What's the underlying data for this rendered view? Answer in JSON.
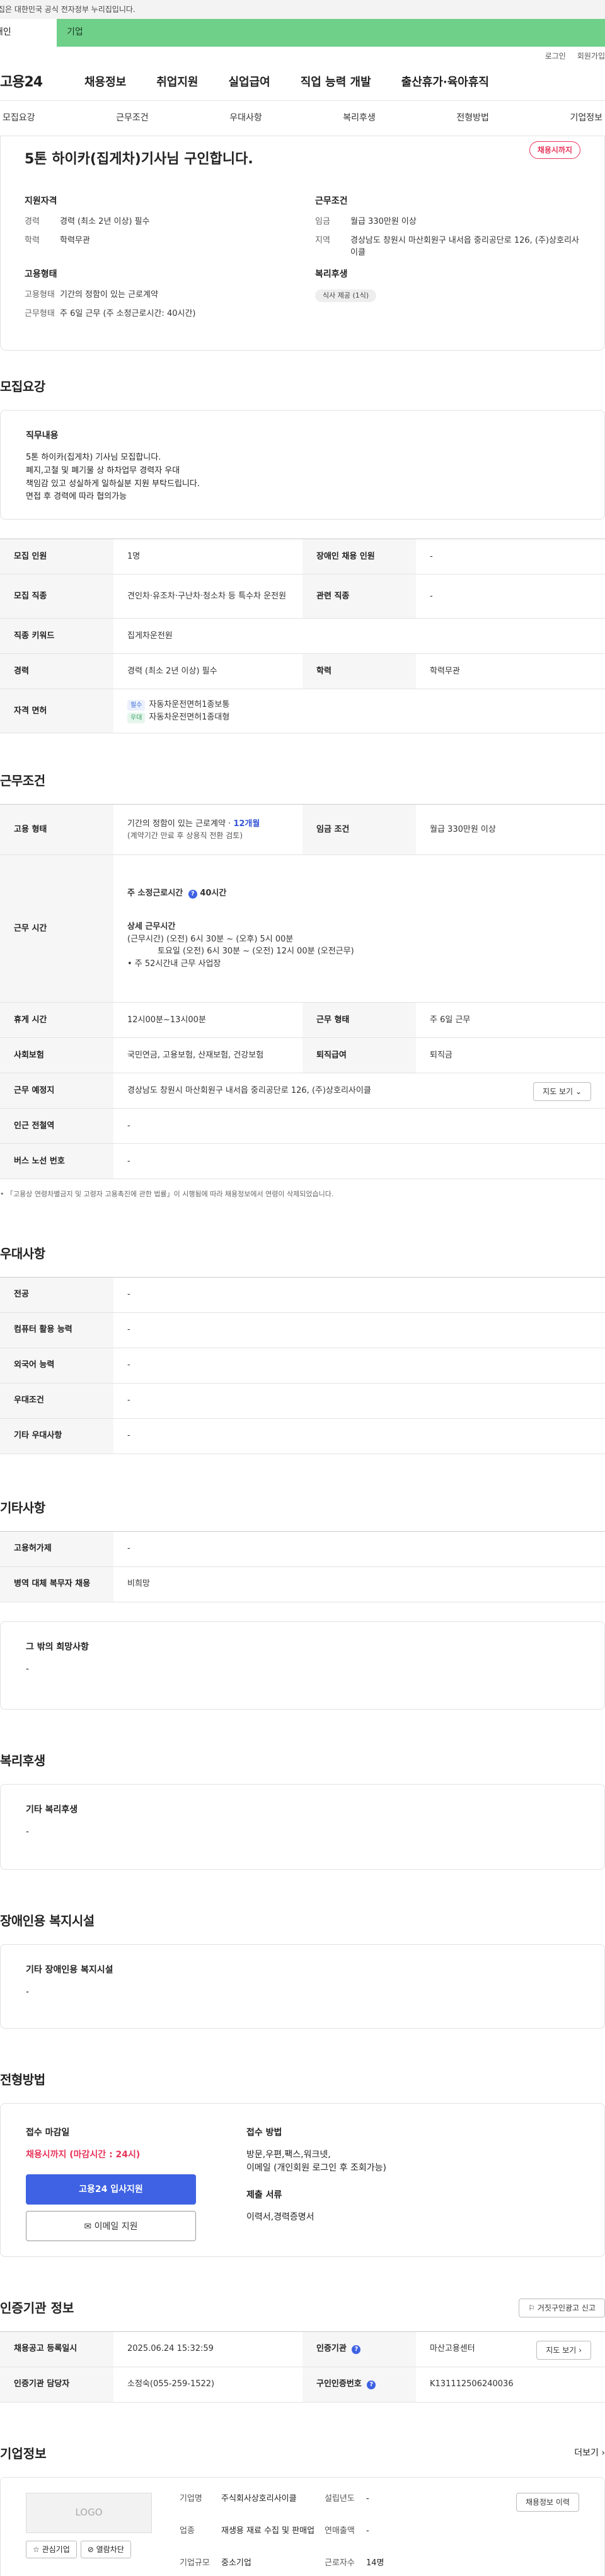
{
  "gov_banner": "이 누리집은 대한민국 공식 전자정부 누리집입니다.",
  "top_tabs": {
    "personal": "개인",
    "business": "기업"
  },
  "util": {
    "login": "로그인",
    "join": "회원가입"
  },
  "gnb": {
    "logo": "고용24",
    "menu": [
      "채용정보",
      "취업지원",
      "실업급여",
      "직업 능력 개발",
      "출산휴가·육아휴직"
    ]
  },
  "subnav": [
    "모집요강",
    "근무조건",
    "우대사항",
    "복리후생",
    "전형방법",
    "기업정보"
  ],
  "job": {
    "title": "5톤 하이카(집게차)기사님 구인합니다.",
    "badge": "채용시까지",
    "qual_title": "지원자격",
    "career_k": "경력",
    "career_v": "경력 (최소 2년 이상) 필수",
    "edu_k": "학력",
    "edu_v": "학력무관",
    "emp_title": "고용형태",
    "emptype_k": "고용형태",
    "emptype_v": "기간의 정함이 있는 근로계약",
    "worktype_k": "근무형태",
    "worktype_v": "주 6일 근무 (주 소정근로시간: 40시간)",
    "cond_title": "근무조건",
    "wage_k": "임금",
    "wage_v": "월급 330만원 이상",
    "region_k": "지역",
    "region_v": "경상남도 창원시 마산회원구 내서읍 중리공단로 126, (주)상호리사이클",
    "welfare_title": "복리후생",
    "welfare_chip": "식사 제공 (1식)"
  },
  "recruit": {
    "section": "모집요강",
    "duty_title": "직무내용",
    "duty_lines": [
      "5톤 하이카(집게차) 기사님 모집합니다.",
      "폐지,고철 및 폐기물 상 하차업무 경력자 우대",
      "책임감 있고 성실하게 일하실분 지원 부탁드립니다.",
      "면접 후 경력에 따라 협의가능"
    ],
    "count_k": "모집 인원",
    "count_v": "1명",
    "disabled_k": "장애인 채용 인원",
    "disabled_v": "-",
    "job_k": "모집 직종",
    "job_v": "견인차·유조차·구난차·청소차 등 특수차 운전원",
    "related_k": "관련 직종",
    "related_v": "-",
    "keyword_k": "직종 키워드",
    "keyword_v": "집게차운전원",
    "career_k": "경력",
    "career_v": "경력 (최소 2년 이상) 필수",
    "edu_k": "학력",
    "edu_v": "학력무관",
    "license_k": "자격 면허",
    "license_req_tag": "필수",
    "license_req": "자동차운전면허1종보통",
    "license_opt_tag": "우대",
    "license_opt": "자동차운전면허1종대형"
  },
  "work": {
    "section": "근무조건",
    "emptype_k": "고용 형태",
    "emptype_v1": "기간의 정함이 있는 근로계약 · ",
    "emptype_term": "12개월",
    "emptype_v2": "(계약기간 만료 후 상용직 전환 검토)",
    "wage_k": "임금 조건",
    "wage_v": "월급 330만원 이상",
    "hours_k": "근무 시간",
    "hours_week": "주 소정근로시간",
    "hours_week_v": "40시간",
    "hours_detail_title": "상세 근무시간",
    "hours_line1": "(근무시간) (오전) 6시 30분 ~ (오후) 5시 00분",
    "hours_line2": "토요일 (오전) 6시 30분 ~ (오전) 12시 00분 (오전근무)",
    "hours_line3": "• 주 52시간내 근무 사업장",
    "rest_k": "휴게 시간",
    "rest_v": "12시00분~13시00분",
    "form_k": "근무 형태",
    "form_v": "주 6일 근무",
    "insurance_k": "사회보험",
    "insurance_v": "국민연금, 고용보험, 산재보험, 건강보험",
    "severance_k": "퇴직급여",
    "severance_v": "퇴직금",
    "place_k": "근무 예정지",
    "place_v": "경상남도 창원시 마산회원구 내서읍 중리공단로 126, (주)상호리사이클",
    "map_btn": "지도 보기",
    "subway_k": "인근 전철역",
    "subway_v": "-",
    "bus_k": "버스 노선 번호",
    "bus_v": "-",
    "notice": "• 「고용상 연령차별금지 및 고령자 고용촉진에 관한 법률」이 시행됨에 따라 채용정보에서 연령이 삭제되었습니다."
  },
  "pref": {
    "section": "우대사항",
    "major_k": "전공",
    "major_v": "-",
    "computer_k": "컴퓨터 활용 능력",
    "computer_v": "-",
    "lang_k": "외국어 능력",
    "lang_v": "-",
    "cond_k": "우대조건",
    "cond_v": "-",
    "etc_k": "기타 우대사항",
    "etc_v": "-"
  },
  "etc": {
    "section": "기타사항",
    "permit_k": "고용허가제",
    "permit_v": "-",
    "military_k": "병역 대체 복무자 채용",
    "military_v": "비희망",
    "other_title": "그 밖의 희망사항",
    "other_v": "-"
  },
  "welfare": {
    "section": "복리후생",
    "title": "기타 복리후생",
    "value": "-"
  },
  "facility": {
    "section": "장애인용 복지시설",
    "title": "기타 장애인용 복지시설",
    "value": "-"
  },
  "apply": {
    "section": "전형방법",
    "deadline_title": "접수 마감일",
    "deadline_v": "채용시까지 (마감시간 : 24시)",
    "apply_btn": "고용24 입사지원",
    "email_btn": "이메일 지원",
    "method_title": "접수 방법",
    "method_v1": "방문,우편,팩스,워크넷,",
    "method_v2": "이메일 (개인회원 로그인 후 조회가능)",
    "docs_title": "제출 서류",
    "docs_v": "이력서,경력증명서"
  },
  "cert": {
    "section": "인증기관 정보",
    "report_btn": "거짓구인광고 신고",
    "reg_k": "채용공고 등록일시",
    "reg_v": "2025.06.24 15:32:59",
    "org_k": "인증기관",
    "org_v": "마산고용센터",
    "map_btn": "지도 보기",
    "manager_k": "인증기관 담당자",
    "manager_v": "소정숙(055-259-1522)",
    "no_k": "구인인증번호",
    "no_v": "K131112506240036"
  },
  "company": {
    "section": "기업정보",
    "more": "더보기",
    "logo": "LOGO",
    "fav_btn": "관심기업",
    "block_btn": "열람차단",
    "name_k": "기업명",
    "name_v": "주식회사상호리사이클",
    "industry_k": "업종",
    "industry_v": "재생용 재료 수집 및 판매업",
    "size_k": "기업규모",
    "size_v": "중소기업",
    "year_k": "설립년도",
    "year_v": "-",
    "sales_k": "연매출액",
    "sales_v": "-",
    "staff_k": "근로자수",
    "staff_v": "14명",
    "history_btn": "채용정보 이력"
  }
}
